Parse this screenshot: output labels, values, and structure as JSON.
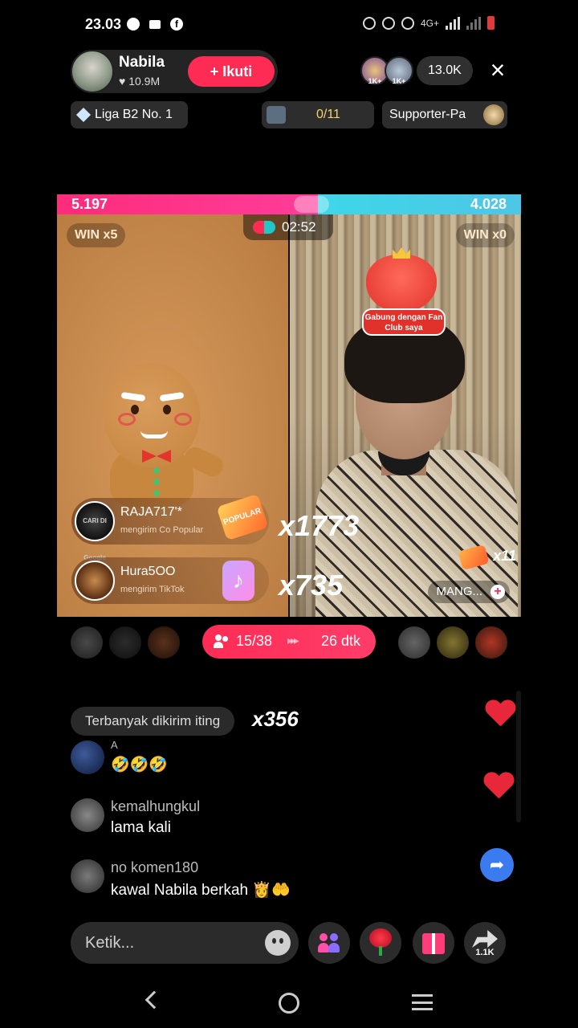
{
  "status_bar": {
    "time": "23.03",
    "network": "4G+"
  },
  "header": {
    "host_name": "Nabila",
    "host_likes": "10.9M",
    "follow_label": "+ Ikuti",
    "viewer_badge_1": "1K+",
    "viewer_badge_2": "1K+",
    "viewer_count": "13.0K",
    "close_icon": "×"
  },
  "chips": {
    "league": "Liga B2 No. 1",
    "progress": "0/11",
    "supporter": "Supporter-Pa"
  },
  "battle": {
    "score_left": "5.197",
    "score_right": "4.028",
    "score_left_fraction": 0.563,
    "timer": "02:52",
    "win_left": "WIN x5",
    "win_right": "WIN x0",
    "fanclub_text": "Gabung dengan Fan Club saya",
    "mang_label": "MANG...",
    "small_multiplier": "x11",
    "gifts": [
      {
        "user": "RAJA717'*",
        "text": "mengirim Co Popular",
        "multiplier": "x1773",
        "avatar_text": "CARI DI Google",
        "gift_label": "POPULAR"
      },
      {
        "user": "Hura5OO",
        "text": "mengirim TikTok",
        "multiplier": "x735",
        "gift_label": "♪"
      }
    ]
  },
  "match": {
    "participants": "15/38",
    "countdown": "26 dtk",
    "ff_icon": "▸▸▸"
  },
  "chat": {
    "top_sent_label": "Terbanyak dikirim iting",
    "top_sent_multiplier": "x356",
    "messages": [
      {
        "user": "A",
        "text": "🤣🤣🤣"
      },
      {
        "user": "kemalhungkul",
        "text": "lama kali"
      },
      {
        "user": "no komen180",
        "text": "kawal Nabila berkah 👸🤲"
      }
    ]
  },
  "bottom_bar": {
    "input_placeholder": "Ketik...",
    "share_count": "1.1K"
  },
  "icons": {
    "share_fab": "➦"
  },
  "colors": {
    "accent": "#fe2c55",
    "score_left": "#fe2c7a",
    "score_right": "#3dd7e8",
    "heart": "#e8283a"
  }
}
